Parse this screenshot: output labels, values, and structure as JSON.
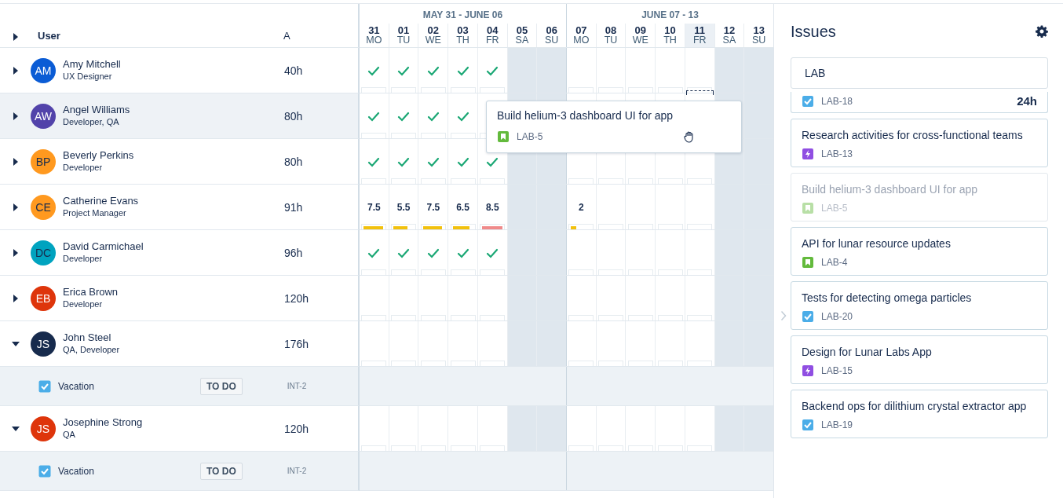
{
  "table": {
    "expand_all": {
      "expanded": false
    },
    "columns": [
      {
        "label": "User"
      },
      {
        "label": "A"
      }
    ]
  },
  "weeks": [
    {
      "label": "MAY 31 - JUNE 06"
    },
    {
      "label": "JUNE 07 - 13"
    }
  ],
  "days": [
    {
      "date": "31",
      "weekday": "MO",
      "weekend": false,
      "highlighted": false
    },
    {
      "date": "01",
      "weekday": "TU",
      "weekend": false,
      "highlighted": false
    },
    {
      "date": "02",
      "weekday": "WE",
      "weekend": false,
      "highlighted": false
    },
    {
      "date": "03",
      "weekday": "TH",
      "weekend": false,
      "highlighted": false
    },
    {
      "date": "04",
      "weekday": "FR",
      "weekend": false,
      "highlighted": false
    },
    {
      "date": "05",
      "weekday": "SA",
      "weekend": true,
      "highlighted": false
    },
    {
      "date": "06",
      "weekday": "SU",
      "weekend": true,
      "highlighted": false
    },
    {
      "date": "07",
      "weekday": "MO",
      "weekend": false,
      "highlighted": false
    },
    {
      "date": "08",
      "weekday": "TU",
      "weekend": false,
      "highlighted": false
    },
    {
      "date": "09",
      "weekday": "WE",
      "weekend": false,
      "highlighted": false
    },
    {
      "date": "10",
      "weekday": "TH",
      "weekend": false,
      "highlighted": false
    },
    {
      "date": "11",
      "weekday": "FR",
      "weekend": false,
      "highlighted": true
    },
    {
      "date": "12",
      "weekday": "SA",
      "weekend": true,
      "highlighted": false
    },
    {
      "date": "13",
      "weekday": "SU",
      "weekend": true,
      "highlighted": false
    }
  ],
  "users": [
    {
      "initials": "AM",
      "name": "Amy Mitchell",
      "role": "UX Designer",
      "total": "40h",
      "color": "#0b5cd5",
      "dark_initials": false,
      "expanded": false,
      "selected": false,
      "cells": [
        {
          "kind": "check"
        },
        {
          "kind": "check"
        },
        {
          "kind": "check"
        },
        {
          "kind": "check"
        },
        {
          "kind": "check"
        }
      ]
    },
    {
      "initials": "AW",
      "name": "Angel Williams",
      "role": "Developer, QA",
      "total": "80h",
      "color": "#5243aa",
      "dark_initials": false,
      "expanded": false,
      "selected": true,
      "cells": [
        {
          "kind": "check"
        },
        {
          "kind": "check"
        },
        {
          "kind": "check"
        },
        {
          "kind": "check"
        },
        {
          "kind": "empty"
        },
        {
          "kind": "empty"
        },
        {
          "kind": "empty"
        },
        {
          "kind": "covered"
        },
        {
          "kind": "covered"
        },
        {
          "kind": "covered"
        },
        {
          "kind": "covered"
        },
        {
          "kind": "empty",
          "drop_target": true
        }
      ]
    },
    {
      "initials": "BP",
      "name": "Beverly Perkins",
      "role": "Developer",
      "total": "80h",
      "color": "#ff991f",
      "dark_initials": true,
      "expanded": false,
      "selected": false,
      "cells": [
        {
          "kind": "check"
        },
        {
          "kind": "check"
        },
        {
          "kind": "check"
        },
        {
          "kind": "check"
        },
        {
          "kind": "check"
        }
      ]
    },
    {
      "initials": "CE",
      "name": "Catherine Evans",
      "role": "Project Manager",
      "total": "91h",
      "color": "#ff991f",
      "dark_initials": true,
      "expanded": false,
      "selected": false,
      "cells": [
        {
          "kind": "hours",
          "value": "7.5",
          "level": 0.94,
          "color": "#f2c10d"
        },
        {
          "kind": "hours",
          "value": "5.5",
          "level": 0.69,
          "color": "#f2c10d"
        },
        {
          "kind": "hours",
          "value": "7.5",
          "level": 0.94,
          "color": "#f2c10d"
        },
        {
          "kind": "hours",
          "value": "6.5",
          "level": 0.81,
          "color": "#f2c10d"
        },
        {
          "kind": "hours",
          "value": "8.5",
          "level": 1,
          "color": "#f08a8a"
        },
        {
          "kind": "empty"
        },
        {
          "kind": "empty"
        },
        {
          "kind": "hours",
          "value": "2",
          "level": 0.25,
          "color": "#f2c10d"
        }
      ]
    },
    {
      "initials": "DC",
      "name": "David Carmichael",
      "role": "Developer",
      "total": "96h",
      "color": "#00a3bf",
      "dark_initials": true,
      "expanded": false,
      "selected": false,
      "cells": [
        {
          "kind": "check"
        },
        {
          "kind": "check"
        },
        {
          "kind": "check"
        },
        {
          "kind": "check"
        },
        {
          "kind": "check"
        }
      ]
    },
    {
      "initials": "EB",
      "name": "Erica Brown",
      "role": "Developer",
      "total": "120h",
      "color": "#de350b",
      "dark_initials": false,
      "expanded": false,
      "selected": false
    },
    {
      "initials": "JS",
      "name": "John Steel",
      "role": "QA, Developer",
      "total": "176h",
      "color": "#172b4d",
      "dark_initials": false,
      "expanded": true,
      "selected": false,
      "tasks": [
        {
          "title": "Vacation",
          "checked": true,
          "status": "TO DO",
          "key": "INT-2"
        }
      ]
    },
    {
      "initials": "JS",
      "name": "Josephine Strong",
      "role": "QA",
      "total": "120h",
      "color": "#de350b",
      "dark_initials": false,
      "expanded": true,
      "selected": false,
      "tasks": [
        {
          "title": "Vacation",
          "checked": true,
          "status": "TO DO",
          "key": "INT-2"
        }
      ]
    }
  ],
  "drag_card": {
    "title": "Build helium-3 dashboard UI for app",
    "key": "LAB-5",
    "kind": "story"
  },
  "issues_panel": {
    "title": "Issues",
    "search": {
      "value": "LAB"
    },
    "issues": [
      {
        "key": "LAB-18",
        "kind": "task",
        "estimate": "24h",
        "dragging": false
      },
      {
        "title": "Research activities for cross-functional teams",
        "key": "LAB-13",
        "kind": "epic",
        "dragging": false
      },
      {
        "title": "Build helium-3 dashboard UI for app",
        "key": "LAB-5",
        "kind": "story",
        "dragging": true
      },
      {
        "title": "API for lunar resource updates",
        "key": "LAB-4",
        "kind": "story",
        "dragging": false
      },
      {
        "title": "Tests for detecting omega particles",
        "key": "LAB-20",
        "kind": "task",
        "dragging": false
      },
      {
        "title": "Design for Lunar Labs App",
        "key": "LAB-15",
        "kind": "epic",
        "dragging": false
      },
      {
        "title": "Backend ops for dilithium crystal extractor app",
        "key": "LAB-19",
        "kind": "task",
        "dragging": false
      }
    ]
  }
}
